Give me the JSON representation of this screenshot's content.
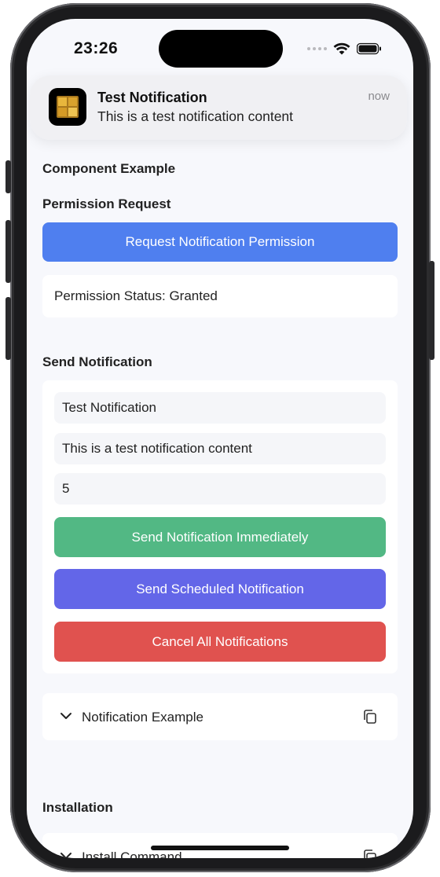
{
  "status_bar": {
    "time": "23:26"
  },
  "notification_banner": {
    "title": "Test Notification",
    "body": "This is a test notification content",
    "time": "now",
    "icon": "app-icon"
  },
  "sections": {
    "component_example": "Component Example",
    "permission_request": "Permission Request",
    "send_notification": "Send Notification",
    "installation": "Installation"
  },
  "permission": {
    "button_label": "Request Notification Permission",
    "status_text": "Permission Status: Granted"
  },
  "send_form": {
    "title_value": "Test Notification",
    "body_value": "This is a test notification content",
    "delay_value": "5",
    "send_now_label": "Send Notification Immediately",
    "send_scheduled_label": "Send Scheduled Notification",
    "cancel_all_label": "Cancel All Notifications"
  },
  "examples": {
    "notification_example_label": "Notification Example",
    "install_command_label": "Install Command"
  },
  "colors": {
    "primary": "#4f7fef",
    "success": "#52b884",
    "indigo": "#6366e8",
    "danger": "#e0524f"
  }
}
